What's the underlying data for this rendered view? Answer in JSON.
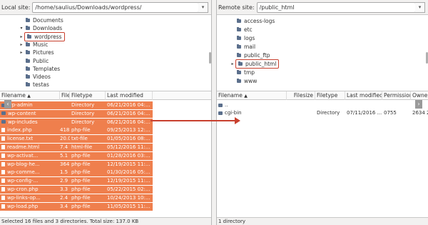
{
  "local": {
    "label": "Local site:",
    "path": "/home/saulius/Downloads/wordpress/",
    "tree": [
      {
        "name": "Documents",
        "twisty": ""
      },
      {
        "name": "Downloads",
        "twisty": "▾"
      },
      {
        "name": "wordpress",
        "twisty": "▸",
        "highlighted": true
      },
      {
        "name": "Music",
        "twisty": "▸"
      },
      {
        "name": "Pictures",
        "twisty": "▸"
      },
      {
        "name": "Public",
        "twisty": ""
      },
      {
        "name": "Templates",
        "twisty": ""
      },
      {
        "name": "Videos",
        "twisty": ""
      },
      {
        "name": "testas",
        "twisty": ""
      }
    ],
    "columns": [
      "Filename",
      "Filesize",
      "Filetype",
      "Last modified"
    ],
    "rows": [
      {
        "name": "wp-admin",
        "size": "",
        "type": "Directory",
        "modified": "06/21/2016 04:...",
        "dir": true
      },
      {
        "name": "wp-content",
        "size": "",
        "type": "Directory",
        "modified": "06/21/2016 04:...",
        "dir": true
      },
      {
        "name": "wp-includes",
        "size": "",
        "type": "Directory",
        "modified": "06/21/2016 04:...",
        "dir": true
      },
      {
        "name": "index.php",
        "size": "418 B",
        "type": "php-file",
        "modified": "09/25/2013 12:..."
      },
      {
        "name": "license.txt",
        "size": "20.0 KB",
        "type": "txt-file",
        "modified": "01/05/2016 08:..."
      },
      {
        "name": "readme.html",
        "size": "7.4 KB",
        "type": "html-file",
        "modified": "05/12/2016 11:..."
      },
      {
        "name": "wp-activat...",
        "size": "5.1 KB",
        "type": "php-file",
        "modified": "01/28/2016 03:..."
      },
      {
        "name": "wp-blog-he...",
        "size": "364 B",
        "type": "php-file",
        "modified": "12/19/2015 11:..."
      },
      {
        "name": "wp-comme...",
        "size": "1.5 KB",
        "type": "php-file",
        "modified": "01/30/2016 05:..."
      },
      {
        "name": "wp-config-...",
        "size": "2.9 KB",
        "type": "php-file",
        "modified": "12/19/2015 11:..."
      },
      {
        "name": "wp-cron.php",
        "size": "3.3 KB",
        "type": "php-file",
        "modified": "05/22/2015 02:..."
      },
      {
        "name": "wp-links-op...",
        "size": "2.4 KB",
        "type": "php-file",
        "modified": "10/24/2013 10:..."
      },
      {
        "name": "wp-load.php",
        "size": "3.4 KB",
        "type": "php-file",
        "modified": "11/05/2015 11:..."
      }
    ],
    "status": "Selected 16 files and 3 directories. Total size: 137.0 KB"
  },
  "remote": {
    "label": "Remote site:",
    "path": "/public_html",
    "tree": [
      {
        "name": "access-logs",
        "twisty": ""
      },
      {
        "name": "etc",
        "twisty": ""
      },
      {
        "name": "logs",
        "twisty": ""
      },
      {
        "name": "mail",
        "twisty": ""
      },
      {
        "name": "public_ftp",
        "twisty": ""
      },
      {
        "name": "public_html",
        "twisty": "▸",
        "highlighted": true
      },
      {
        "name": "tmp",
        "twisty": ""
      },
      {
        "name": "www",
        "twisty": ""
      }
    ],
    "columns": [
      "Filename",
      "Filesize",
      "Filetype",
      "Last modified",
      "Permission",
      "Owner"
    ],
    "rows": [
      {
        "name": "..",
        "size": "",
        "type": "",
        "modified": "",
        "perm": "",
        "owner": "",
        "dir": true
      },
      {
        "name": "cgi-bin",
        "size": "",
        "type": "Directory",
        "modified": "07/11/2016 ...",
        "perm": "0755",
        "owner": "2634 2€",
        "dir": true
      }
    ],
    "status": "1 directory"
  },
  "colors": {
    "selection": "#ef7f4d",
    "highlight": "#c8402e",
    "folder": "#5b6f8c"
  },
  "nav": {
    "left": "‹",
    "right": "›"
  },
  "icons": {
    "sort": "▲",
    "dropdown": "▾"
  }
}
